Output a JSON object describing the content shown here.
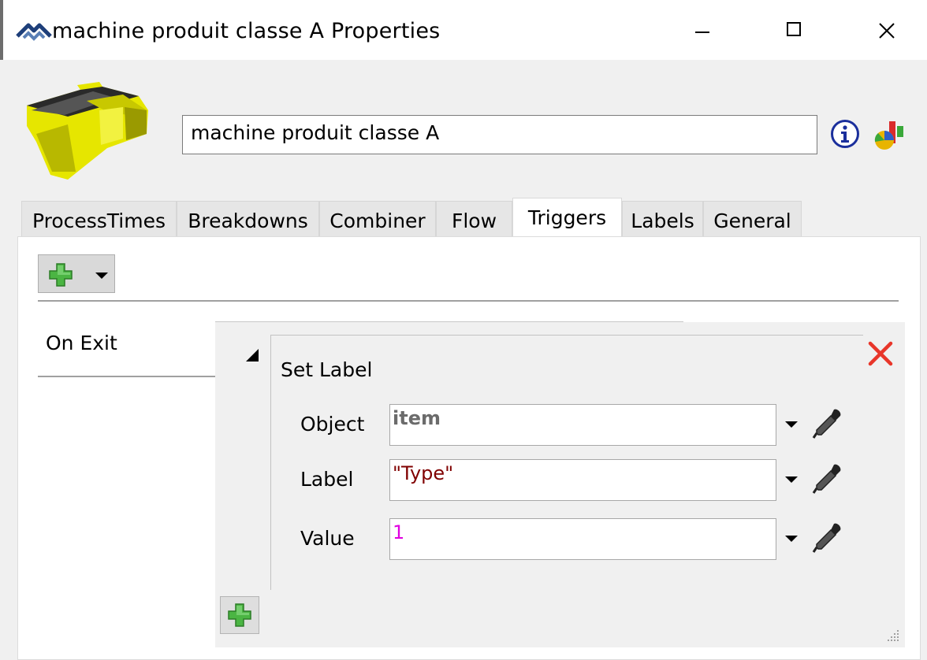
{
  "window": {
    "title": "machine produit classe A  Properties",
    "buttons": {
      "minimize": "minimize-icon",
      "maximize": "maximize-icon",
      "close": "close-icon"
    }
  },
  "object": {
    "name": "machine produit classe A"
  },
  "tabs": [
    {
      "label": "ProcessTimes",
      "active": false
    },
    {
      "label": "Breakdowns",
      "active": false
    },
    {
      "label": "Combiner",
      "active": false
    },
    {
      "label": "Flow",
      "active": false
    },
    {
      "label": "Triggers",
      "active": true
    },
    {
      "label": "Labels",
      "active": false
    },
    {
      "label": "General",
      "active": false
    }
  ],
  "triggers": {
    "list": [
      {
        "label": "On Exit"
      }
    ],
    "action": {
      "title": "Set Label",
      "fields": [
        {
          "label": "Object",
          "value": "item",
          "color": "#6b6b6b"
        },
        {
          "label": "Label",
          "value": "\"Type\"",
          "color": "#800000"
        },
        {
          "label": "Value",
          "value": "1",
          "color": "#e000e0"
        }
      ]
    }
  },
  "colors": {
    "accent_remove": "#e8362a",
    "plus_green": "#4bb543",
    "object_yellow": "#e6e600"
  }
}
